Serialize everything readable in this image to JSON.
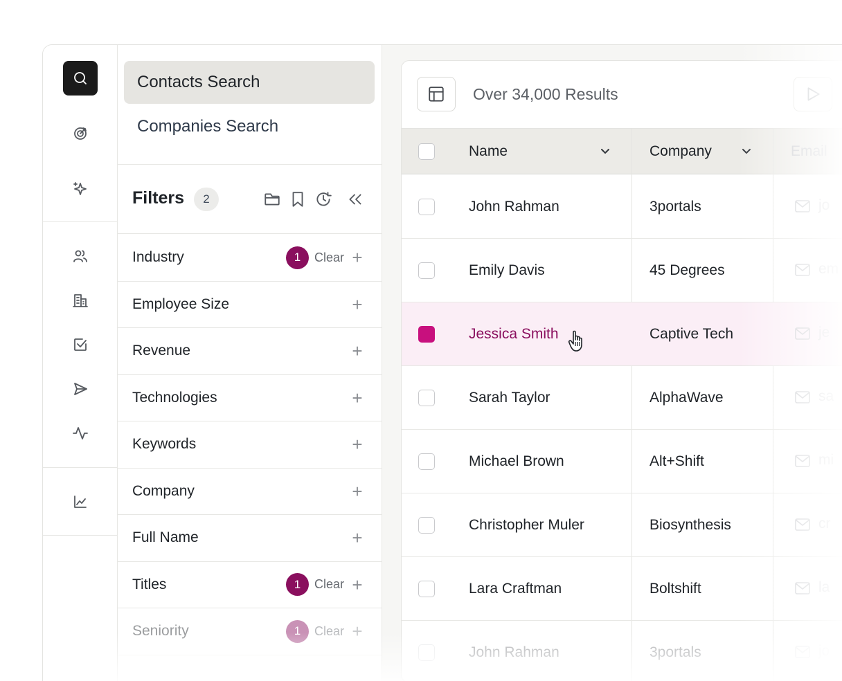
{
  "nav": {
    "contacts_search": "Contacts Search",
    "companies_search": "Companies Search"
  },
  "filters": {
    "title": "Filters",
    "count": "2",
    "items": [
      {
        "label": "Industry",
        "badge": "1",
        "clear": "Clear"
      },
      {
        "label": "Employee Size"
      },
      {
        "label": "Revenue"
      },
      {
        "label": "Technologies"
      },
      {
        "label": "Keywords"
      },
      {
        "label": "Company"
      },
      {
        "label": "Full Name"
      },
      {
        "label": "Titles",
        "badge": "1",
        "clear": "Clear"
      },
      {
        "label": "Seniority",
        "badge": "1",
        "clear": "Clear"
      }
    ]
  },
  "results": {
    "summary": "Over 34,000 Results"
  },
  "table": {
    "columns": [
      "Name",
      "Company",
      "Email"
    ],
    "rows": [
      {
        "name": "John Rahman",
        "company": "3portals",
        "email": "jo"
      },
      {
        "name": "Emily Davis",
        "company": "45 Degrees",
        "email": "em"
      },
      {
        "name": "Jessica Smith",
        "company": "Captive Tech",
        "email": "je",
        "selected": true
      },
      {
        "name": "Sarah Taylor",
        "company": "AlphaWave",
        "email": "sa"
      },
      {
        "name": "Michael Brown",
        "company": "Alt+Shift",
        "email": "mi"
      },
      {
        "name": "Christopher Muler",
        "company": "Biosynthesis",
        "email": "cr"
      },
      {
        "name": "Lara Craftman",
        "company": "Boltshift",
        "email": "la"
      },
      {
        "name": "John Rahman",
        "company": "3portals",
        "email": "jo"
      }
    ]
  },
  "colors": {
    "accent": "#8a0f5e",
    "checkbox_selected": "#c8107e",
    "selected_row": "#fbeef6"
  }
}
